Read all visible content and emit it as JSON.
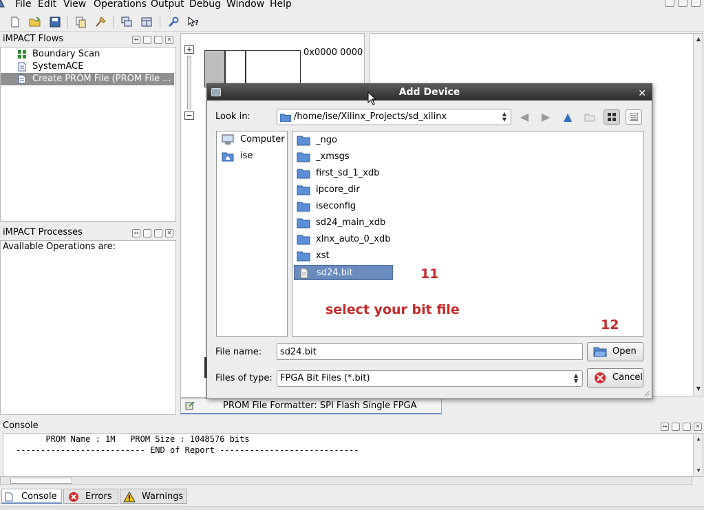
{
  "menu": {
    "items": [
      "File",
      "Edit",
      "View",
      "Operations",
      "Output",
      "Debug",
      "Window",
      "Help"
    ]
  },
  "flows_panel": {
    "title": "iMPACT Flows",
    "items": [
      {
        "label": "Boundary Scan",
        "icon": "boundary-scan-icon"
      },
      {
        "label": "SystemACE",
        "icon": "document-icon"
      },
      {
        "label": "Create PROM File (PROM File ...",
        "icon": "document-icon",
        "selected": true
      }
    ]
  },
  "processes_panel": {
    "title": "iMPACT Processes",
    "text": "Available Operations are:"
  },
  "canvas": {
    "address_label": "0x0000  0000"
  },
  "prom_tab": {
    "label": "PROM File Formatter: SPI Flash Single FPGA"
  },
  "console": {
    "title": "Console",
    "lines": [
      "      PROM Name : 1M   PROM Size : 1048576 bits",
      "-------------------------- END of Report ----------------------------"
    ]
  },
  "bottom_tabs": {
    "console": "Console",
    "errors": "Errors",
    "warnings": "Warnings"
  },
  "dialog": {
    "title": "Add Device",
    "look_in_label": "Look in:",
    "look_in_path": "/home/ise/Xilinx_Projects/sd_xilinx",
    "places": [
      {
        "label": "Computer",
        "icon": "computer-icon"
      },
      {
        "label": "ise",
        "icon": "home-folder-icon"
      }
    ],
    "files": [
      {
        "label": "_ngo",
        "type": "folder"
      },
      {
        "label": "_xmsgs",
        "type": "folder"
      },
      {
        "label": "first_sd_1_xdb",
        "type": "folder"
      },
      {
        "label": "ipcore_dir",
        "type": "folder"
      },
      {
        "label": "iseconfig",
        "type": "folder"
      },
      {
        "label": "sd24_main_xdb",
        "type": "folder"
      },
      {
        "label": "xlnx_auto_0_xdb",
        "type": "folder"
      },
      {
        "label": "xst",
        "type": "folder"
      },
      {
        "label": "sd24.bit",
        "type": "file",
        "selected": true
      }
    ],
    "file_name_label": "File name:",
    "file_name_value": "sd24.bit",
    "file_type_label": "Files of type:",
    "file_type_value": "FPGA Bit Files (*.bit)",
    "open_button": "Open",
    "cancel_button": "Cancel"
  },
  "annotations": {
    "step11": "11",
    "instruction": "select your bit file",
    "step12": "12",
    "color": "#c62828"
  },
  "colors": {
    "selection": "#6a8bbd",
    "titlebar": "#3a3a3a",
    "annotation": "#c62828"
  }
}
